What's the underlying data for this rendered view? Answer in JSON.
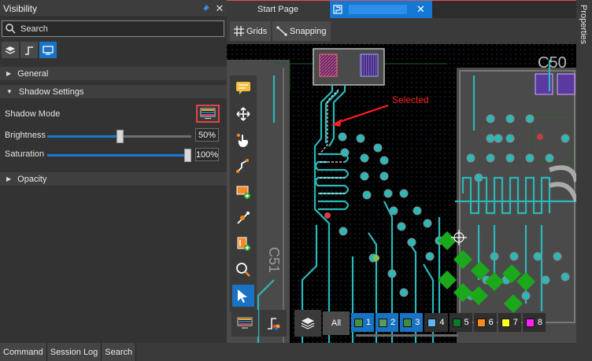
{
  "panel": {
    "title": "Visibility",
    "search_placeholder": "Search",
    "sections": {
      "general": "General",
      "shadow_settings": "Shadow Settings",
      "opacity": "Opacity"
    },
    "shadow_mode_label": "Shadow Mode",
    "brightness": {
      "label": "Brightness",
      "value": "50%",
      "fraction": 0.5
    },
    "saturation": {
      "label": "Saturation",
      "value": "100%",
      "fraction": 1.0
    }
  },
  "tabs": {
    "start_page": "Start Page"
  },
  "toolbar": {
    "grids": "Grids",
    "snapping": "Snapping"
  },
  "properties_label": "Properties",
  "canvas": {
    "annotation": "Selected",
    "silkscreen": {
      "c50": "C50",
      "c51": "C51"
    }
  },
  "layerbar": {
    "all_label": "All",
    "layers": [
      {
        "label": "1",
        "color": "#4a8f3c",
        "active": true
      },
      {
        "label": "2",
        "color": "#5a9a5a",
        "active": true
      },
      {
        "label": "3",
        "color": "#3f8c4a",
        "active": true
      },
      {
        "label": "4",
        "color": "#66b2f0",
        "active": false
      },
      {
        "label": "5",
        "color": "#0c7a2a",
        "active": false
      },
      {
        "label": "6",
        "color": "#ff8a1a",
        "active": false
      },
      {
        "label": "7",
        "color": "#ffff20",
        "active": false
      },
      {
        "label": "8",
        "color": "#ff20ff",
        "active": false
      }
    ]
  },
  "statusbar": {
    "command": "Command",
    "session_log": "Session Log",
    "search": "Search"
  },
  "colors": {
    "accent": "#1a72c2",
    "highlight_border": "#e04545",
    "annotation": "#ff2020",
    "copper": "#2ab8b8"
  }
}
